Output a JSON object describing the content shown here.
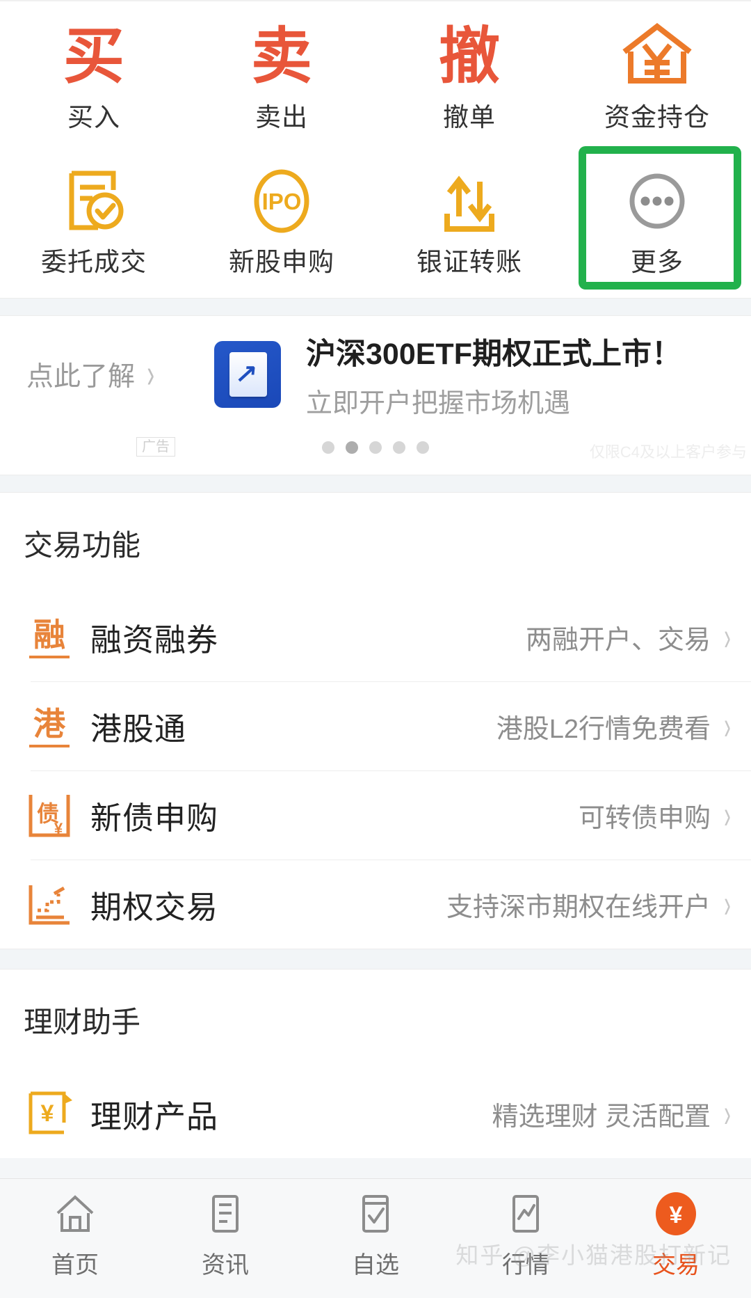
{
  "quick_actions": {
    "row1": [
      {
        "glyph": "买",
        "label": "买入",
        "icon": "buy-char-icon",
        "color": "#e8563a"
      },
      {
        "glyph": "卖",
        "label": "卖出",
        "icon": "sell-char-icon",
        "color": "#e8563a"
      },
      {
        "glyph": "撤",
        "label": "撤单",
        "icon": "cancel-order-char-icon",
        "color": "#e8563a"
      },
      {
        "glyph": "",
        "label": "资金持仓",
        "icon": "house-yuan-icon",
        "color": "#ec7a2a"
      }
    ],
    "row2": [
      {
        "glyph": "",
        "label": "委托成交",
        "icon": "document-check-icon",
        "color": "#edaa1e"
      },
      {
        "glyph": "IPO",
        "label": "新股申购",
        "icon": "ipo-oval-icon",
        "color": "#edaa1e"
      },
      {
        "glyph": "",
        "label": "银证转账",
        "icon": "transfer-arrows-icon",
        "color": "#edaa1e"
      },
      {
        "glyph": "",
        "label": "更多",
        "icon": "more-dots-icon",
        "color": "#9a9a9a",
        "highlighted": true
      }
    ],
    "highlight_color": "#22b14c"
  },
  "ad": {
    "left_text": "点此了解",
    "title": "沪深300ETF期权正式上市！",
    "subtitle": "立即开户把握市场机遇",
    "tag": "广告",
    "note": "仅限C4及以上客户参与",
    "dots_total": 5,
    "dots_active_index": 1
  },
  "sections": [
    {
      "title": "交易功能",
      "rows": [
        {
          "icon": "rong-badge-icon",
          "icon_char": "融",
          "label": "融资融券",
          "hint": "两融开户、交易"
        },
        {
          "icon": "gang-badge-icon",
          "icon_char": "港",
          "label": "港股通",
          "hint": "港股L2行情免费看"
        },
        {
          "icon": "bond-yuan-icon",
          "icon_char": "债",
          "label": "新债申购",
          "hint": "可转债申购"
        },
        {
          "icon": "option-chart-icon",
          "icon_char": "",
          "label": "期权交易",
          "hint": "支持深市期权在线开户"
        }
      ]
    },
    {
      "title": "理财助手",
      "rows": [
        {
          "icon": "wealth-yuan-icon",
          "icon_char": "",
          "label": "理财产品",
          "hint": "精选理财  灵活配置"
        }
      ]
    }
  ],
  "tabbar": {
    "items": [
      {
        "icon": "home-icon",
        "label": "首页",
        "active": false
      },
      {
        "icon": "news-list-icon",
        "label": "资讯",
        "active": false
      },
      {
        "icon": "watchlist-check-icon",
        "label": "自选",
        "active": false
      },
      {
        "icon": "market-chart-icon",
        "label": "行情",
        "active": false
      },
      {
        "icon": "trade-yuan-icon",
        "label": "交易",
        "active": true
      }
    ],
    "accent_color": "#ed5b1e"
  },
  "watermark": "知乎 @李小猫港股打新记"
}
